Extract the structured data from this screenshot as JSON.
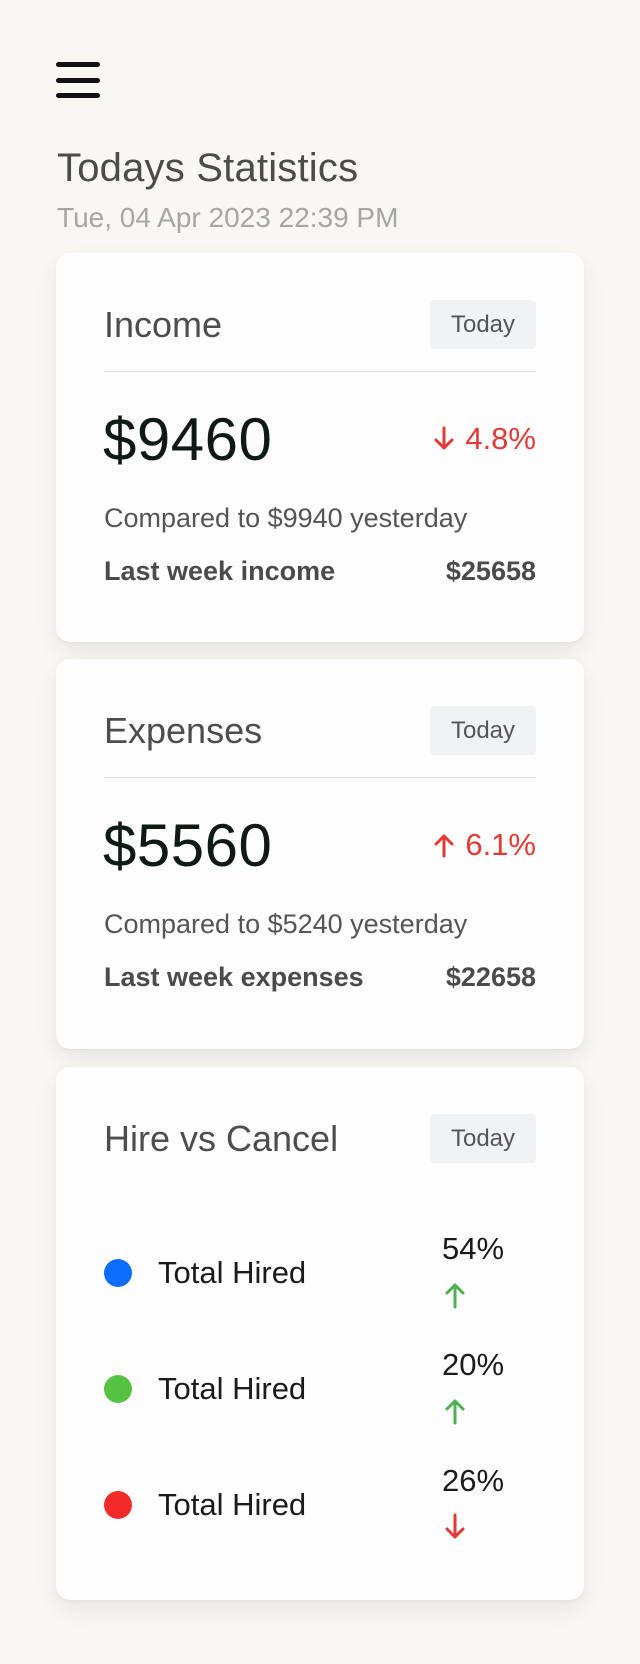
{
  "header": {
    "title": "Todays Statistics",
    "date": "Tue, 04 Apr 2023 22:39 PM"
  },
  "income": {
    "title": "Income",
    "period": "Today",
    "amount": "$9460",
    "delta": "4.8%",
    "delta_direction": "down",
    "compare": "Compared to $9940 yesterday",
    "week_label": "Last week income",
    "week_value": "$25658"
  },
  "expenses": {
    "title": "Expenses",
    "period": "Today",
    "amount": "$5560",
    "delta": "6.1%",
    "delta_direction": "up",
    "compare": "Compared to $5240 yesterday",
    "week_label": "Last week expenses",
    "week_value": "$22658"
  },
  "hire": {
    "title": "Hire vs Cancel",
    "period": "Today",
    "items": [
      {
        "label": "Total Hired",
        "percent": "54%",
        "dot_color": "#0d6efd",
        "trend": "up",
        "trend_color": "#4caf50"
      },
      {
        "label": "Total Hired",
        "percent": "20%",
        "dot_color": "#55c244",
        "trend": "up",
        "trend_color": "#4caf50"
      },
      {
        "label": "Total Hired",
        "percent": "26%",
        "dot_color": "#f22a2a",
        "trend": "down",
        "trend_color": "#e53935"
      }
    ]
  },
  "colors": {
    "negative": "#e53935",
    "positive": "#4caf50"
  }
}
